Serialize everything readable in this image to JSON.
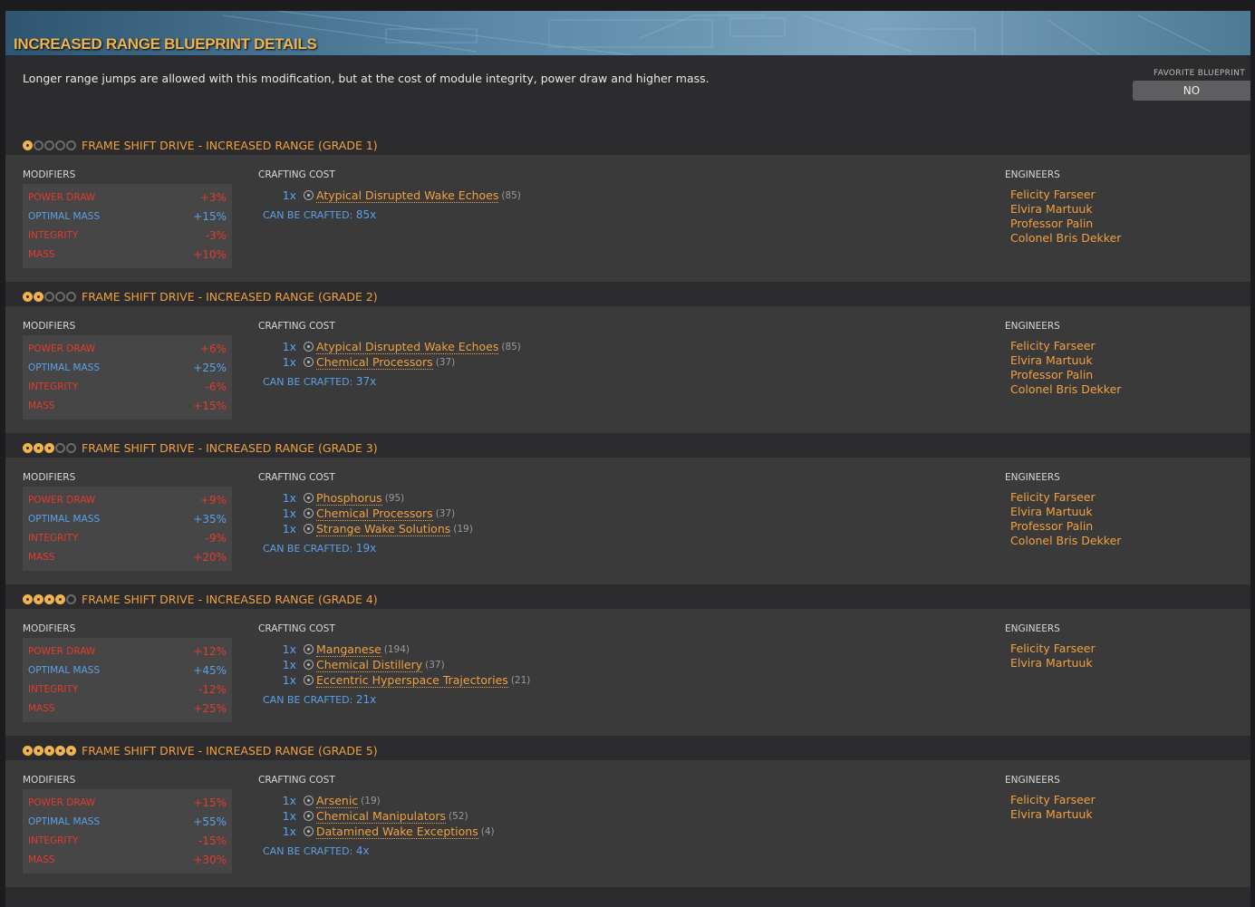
{
  "title": "INCREASED RANGE BLUEPRINT DETAILS",
  "description": "Longer range jumps are allowed with this modification, but at the cost of module integrity, power draw and higher mass.",
  "favorite": {
    "label": "FAVORITE BLUEPRINT",
    "value": "NO"
  },
  "labels": {
    "modifiers": "MODIFIERS",
    "crafting_cost": "CRAFTING COST",
    "engineers": "ENGINEERS",
    "can_be_crafted": "CAN BE CRAFTED:"
  },
  "grades": [
    {
      "title": "FRAME SHIFT DRIVE - INCREASED RANGE (GRADE 1)",
      "grade": 1,
      "modifiers": [
        {
          "name": "POWER DRAW",
          "value": "+3%",
          "color": "red"
        },
        {
          "name": "OPTIMAL MASS",
          "value": "+15%",
          "color": "blue"
        },
        {
          "name": "INTEGRITY",
          "value": "-3%",
          "color": "red"
        },
        {
          "name": "MASS",
          "value": "+10%",
          "color": "red"
        }
      ],
      "materials": [
        {
          "qty": "1x",
          "name": "Atypical Disrupted Wake Echoes",
          "count": "(85)"
        }
      ],
      "craftable": "85x",
      "engineers": [
        "Felicity Farseer",
        "Elvira Martuuk",
        "Professor Palin",
        "Colonel Bris Dekker"
      ]
    },
    {
      "title": "FRAME SHIFT DRIVE - INCREASED RANGE (GRADE 2)",
      "grade": 2,
      "modifiers": [
        {
          "name": "POWER DRAW",
          "value": "+6%",
          "color": "red"
        },
        {
          "name": "OPTIMAL MASS",
          "value": "+25%",
          "color": "blue"
        },
        {
          "name": "INTEGRITY",
          "value": "-6%",
          "color": "red"
        },
        {
          "name": "MASS",
          "value": "+15%",
          "color": "red"
        }
      ],
      "materials": [
        {
          "qty": "1x",
          "name": "Atypical Disrupted Wake Echoes",
          "count": "(85)"
        },
        {
          "qty": "1x",
          "name": "Chemical Processors",
          "count": "(37)"
        }
      ],
      "craftable": "37x",
      "engineers": [
        "Felicity Farseer",
        "Elvira Martuuk",
        "Professor Palin",
        "Colonel Bris Dekker"
      ]
    },
    {
      "title": "FRAME SHIFT DRIVE - INCREASED RANGE (GRADE 3)",
      "grade": 3,
      "modifiers": [
        {
          "name": "POWER DRAW",
          "value": "+9%",
          "color": "red"
        },
        {
          "name": "OPTIMAL MASS",
          "value": "+35%",
          "color": "blue"
        },
        {
          "name": "INTEGRITY",
          "value": "-9%",
          "color": "red"
        },
        {
          "name": "MASS",
          "value": "+20%",
          "color": "red"
        }
      ],
      "materials": [
        {
          "qty": "1x",
          "name": "Phosphorus",
          "count": "(95)"
        },
        {
          "qty": "1x",
          "name": "Chemical Processors",
          "count": "(37)"
        },
        {
          "qty": "1x",
          "name": "Strange Wake Solutions",
          "count": "(19)"
        }
      ],
      "craftable": "19x",
      "engineers": [
        "Felicity Farseer",
        "Elvira Martuuk",
        "Professor Palin",
        "Colonel Bris Dekker"
      ]
    },
    {
      "title": "FRAME SHIFT DRIVE - INCREASED RANGE (GRADE 4)",
      "grade": 4,
      "modifiers": [
        {
          "name": "POWER DRAW",
          "value": "+12%",
          "color": "red"
        },
        {
          "name": "OPTIMAL MASS",
          "value": "+45%",
          "color": "blue"
        },
        {
          "name": "INTEGRITY",
          "value": "-12%",
          "color": "red"
        },
        {
          "name": "MASS",
          "value": "+25%",
          "color": "red"
        }
      ],
      "materials": [
        {
          "qty": "1x",
          "name": "Manganese",
          "count": "(194)"
        },
        {
          "qty": "1x",
          "name": "Chemical Distillery",
          "count": "(37)"
        },
        {
          "qty": "1x",
          "name": "Eccentric Hyperspace Trajectories",
          "count": "(21)"
        }
      ],
      "craftable": "21x",
      "engineers": [
        "Felicity Farseer",
        "Elvira Martuuk"
      ]
    },
    {
      "title": "FRAME SHIFT DRIVE - INCREASED RANGE (GRADE 5)",
      "grade": 5,
      "modifiers": [
        {
          "name": "POWER DRAW",
          "value": "+15%",
          "color": "red"
        },
        {
          "name": "OPTIMAL MASS",
          "value": "+55%",
          "color": "blue"
        },
        {
          "name": "INTEGRITY",
          "value": "-15%",
          "color": "red"
        },
        {
          "name": "MASS",
          "value": "+30%",
          "color": "red"
        }
      ],
      "materials": [
        {
          "qty": "1x",
          "name": "Arsenic",
          "count": "(19)"
        },
        {
          "qty": "1x",
          "name": "Chemical Manipulators",
          "count": "(52)"
        },
        {
          "qty": "1x",
          "name": "Datamined Wake Exceptions",
          "count": "(4)"
        }
      ],
      "craftable": "4x",
      "engineers": [
        "Felicity Farseer",
        "Elvira Martuuk"
      ]
    }
  ]
}
